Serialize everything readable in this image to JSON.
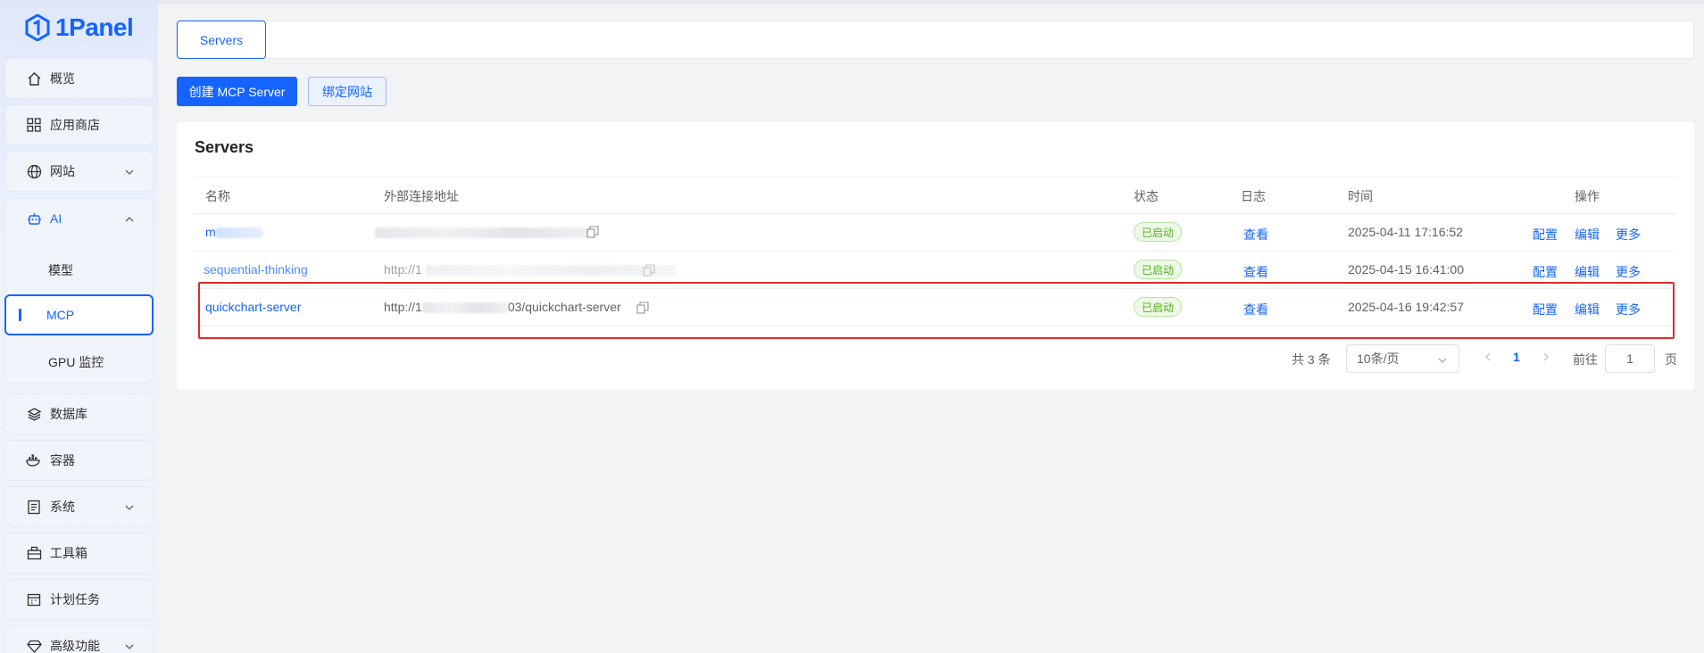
{
  "app": {
    "logo_text": "1Panel"
  },
  "sidebar": {
    "items": [
      {
        "label": "概览",
        "icon": "home-icon"
      },
      {
        "label": "应用商店",
        "icon": "grid-icon"
      },
      {
        "label": "网站",
        "icon": "globe-icon"
      },
      {
        "label": "AI",
        "icon": "robot-icon"
      },
      {
        "label": "模型"
      },
      {
        "label": "MCP"
      },
      {
        "label": "GPU 监控"
      },
      {
        "label": "数据库",
        "icon": "layers-icon"
      },
      {
        "label": "容器",
        "icon": "docker-icon"
      },
      {
        "label": "系统",
        "icon": "system-icon"
      },
      {
        "label": "工具箱",
        "icon": "toolbox-icon"
      },
      {
        "label": "计划任务",
        "icon": "calendar-icon"
      },
      {
        "label": "高级功能",
        "icon": "diamond-icon"
      }
    ]
  },
  "tabs": {
    "active": "Servers"
  },
  "toolbar": {
    "create_label": "创建 MCP Server",
    "bind_label": "绑定网站"
  },
  "card": {
    "title": "Servers"
  },
  "table": {
    "headers": [
      "名称",
      "外部连接地址",
      "状态",
      "日志",
      "时间",
      "操作"
    ],
    "rows": [
      {
        "name": "m",
        "url": "",
        "status": "已启动",
        "log": "查看",
        "time": "2025-04-11 17:16:52",
        "ops": [
          "配置",
          "编辑",
          "更多"
        ]
      },
      {
        "name": "sequential-thinking",
        "url": "http://1",
        "status": "已启动",
        "log": "查看",
        "time": "2025-04-15 16:41:00",
        "ops": [
          "配置",
          "编辑",
          "更多"
        ]
      },
      {
        "name": "quickchart-server",
        "url_prefix": "http://1",
        "url_suffix": "03/quickchart-server",
        "status": "已启动",
        "log": "查看",
        "time": "2025-04-16 19:42:57",
        "ops": [
          "配置",
          "编辑",
          "更多"
        ]
      }
    ]
  },
  "pagination": {
    "total": "共 3 条",
    "page_size": "10条/页",
    "current": "1",
    "goto_label": "前往",
    "goto_value": "1",
    "page_label": "页"
  },
  "colors": {
    "accent": "#1664ff",
    "status_ok": "#52b01f",
    "highlight": "#e02a2a"
  }
}
